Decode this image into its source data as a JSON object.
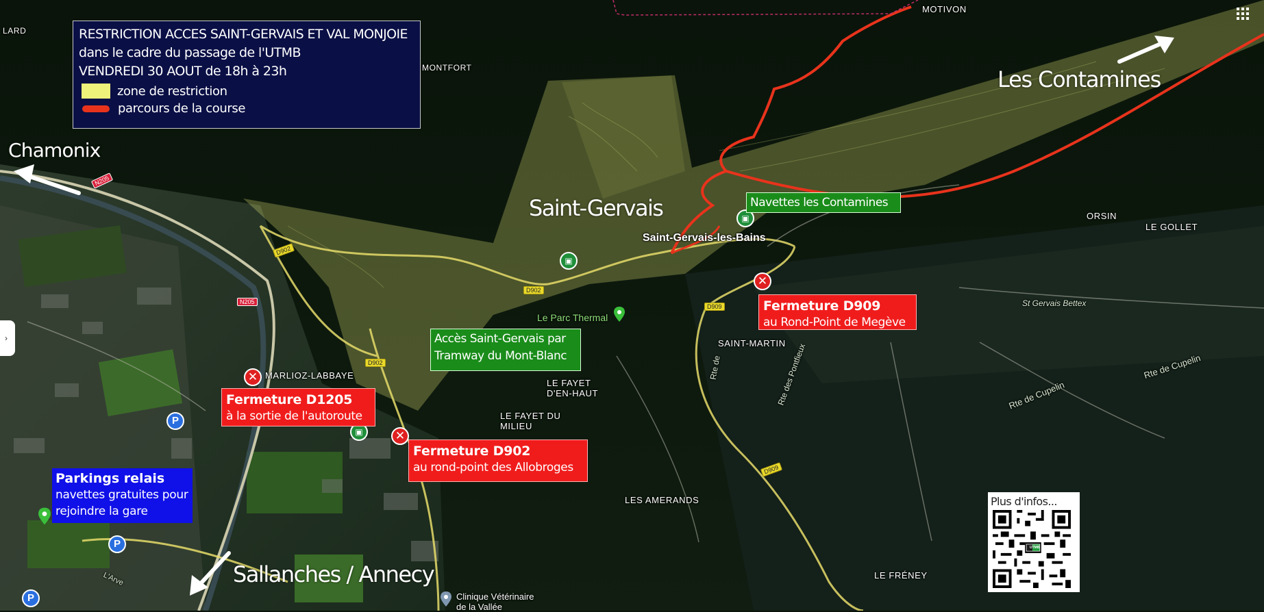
{
  "legend": {
    "title_line1": "RESTRICTION ACCES SAINT-GERVAIS ET VAL MONJOIE",
    "title_line2": "dans le cadre du passage de l'UTMB",
    "title_line3": "VENDREDI 30 AOUT de 18h à 23h",
    "zone_label": "zone de restriction",
    "route_label": "parcours de la course"
  },
  "colors": {
    "restriction_zone": "#eef27a",
    "race_route": "#e8331c",
    "closure": "#f01c1c",
    "shuttle": "#1a8c1a",
    "parking": "#1010e8"
  },
  "destinations": {
    "chamonix": "Chamonix",
    "les_contamines": "Les Contamines",
    "sallanches": "Sallanches / Annecy"
  },
  "town": "Saint-Gervais",
  "closures": [
    {
      "title": "Fermeture D1205",
      "detail": "à la sortie de l'autoroute"
    },
    {
      "title": "Fermeture D902",
      "detail": "au rond-point des Allobroges"
    },
    {
      "title": "Fermeture D909",
      "detail": "au Rond-Point de Megève"
    }
  ],
  "shuttle_box": "Navettes les Contamines",
  "tram_box": {
    "line1": "Accès Saint-Gervais par",
    "line2": "Tramway du Mont-Blanc"
  },
  "parking_box": {
    "title": "Parkings relais",
    "line1": "navettes gratuites pour",
    "line2": "rejoindre la gare"
  },
  "qr_label": "Plus d'infos...",
  "qr_badge": "UTMB",
  "map_labels": {
    "motivon": "MOTIVON",
    "montfort": "MONTFORT",
    "lard": "LARD",
    "saint_gervais_les_bains": "Saint-Gervais-les-Bains",
    "orsin": "ORSIN",
    "le_gollet": "LE GOLLET",
    "st_gervais_bettex": "St Gervais Bettex",
    "saint_martin": "SAINT-MARTIN",
    "marlioz": "MARLIOZ-LABBAYE",
    "parc_thermal": "Le Parc Thermal",
    "fayet_haut": "LE FAYET D'EN-HAUT",
    "fayet_milieu": "LE FAYET DU MILIEU",
    "amerands": "LES AMERANDS",
    "freney": "LE FRÉNEY",
    "clinique1": "Clinique Vétérinaire",
    "clinique2": "de la Vallée",
    "rte_cupelin": "Rte de Cupelin",
    "rte_cupelin2": "Rte de Cupelin",
    "rte_pontfieux": "Rte des Pontfieux",
    "rte_de": "Rte de",
    "arve": "L'Arve"
  },
  "road_badges": {
    "n205a": "N205",
    "n205b": "N205",
    "d902a": "D902",
    "d902b": "D902",
    "d902c": "D902",
    "d909a": "D909",
    "d909b": "D909"
  },
  "icons": {
    "closure_symbol": "✕",
    "parking_symbol": "P"
  }
}
